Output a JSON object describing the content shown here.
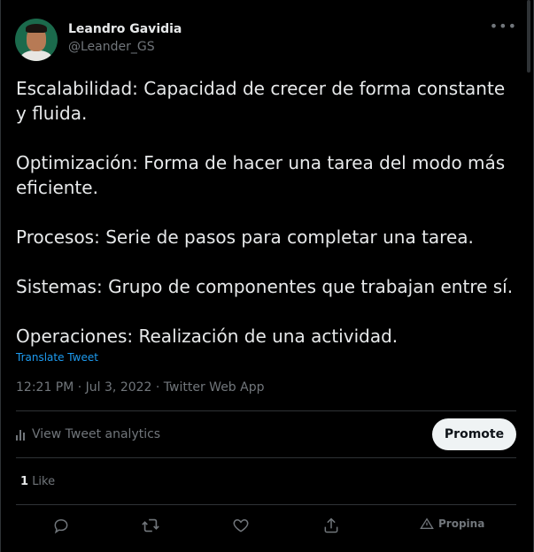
{
  "author": {
    "name": "Leandro Gavidia",
    "handle": "@Leander_GS"
  },
  "tweet": {
    "paragraphs": [
      "Escalabilidad: Capacidad de crecer de forma constante\ny fluida.",
      "Optimización: Forma de hacer una tarea del modo más eficiente.",
      "Procesos: Serie de pasos para completar una tarea.",
      "Sistemas: Grupo de componentes que trabajan entre sí.",
      "Operaciones: Realización de una actividad."
    ],
    "translate_label": "Translate Tweet",
    "meta": "12:21 PM · Jul 3, 2022 · Twitter Web App"
  },
  "analytics": {
    "label": "View Tweet analytics",
    "promote_label": "Promote"
  },
  "stats": {
    "like_count": "1",
    "like_label": "Like"
  },
  "actions": {
    "propina_label": "Propina"
  },
  "icons": {
    "more": "more-icon",
    "reply": "reply-icon",
    "retweet": "retweet-icon",
    "like": "heart-icon",
    "share": "share-icon",
    "tip": "tip-icon",
    "analytics": "analytics-icon"
  },
  "colors": {
    "background": "#000000",
    "text": "#e7e9ea",
    "secondary": "#71767b",
    "link": "#1d9bf0",
    "divider": "#2f3336",
    "button_bg": "#eff3f4"
  }
}
